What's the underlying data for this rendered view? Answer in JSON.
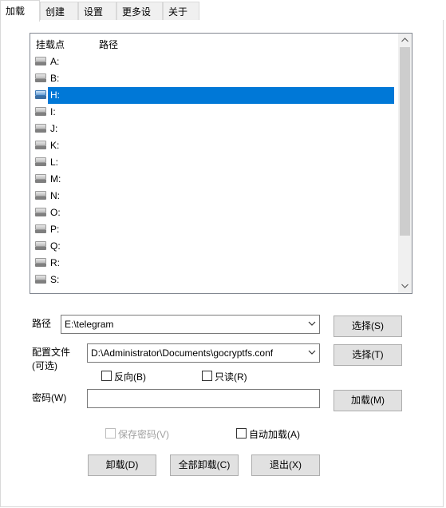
{
  "tabs": [
    {
      "label": "加载",
      "active": true
    },
    {
      "label": "创建",
      "active": false
    },
    {
      "label": "设置",
      "active": false
    },
    {
      "label": "更多设置",
      "active": false
    },
    {
      "label": "关于",
      "active": false
    }
  ],
  "mount_list": {
    "columns": [
      "挂载点",
      "路径"
    ],
    "rows": [
      {
        "drive": "A:",
        "path": ""
      },
      {
        "drive": "B:",
        "path": ""
      },
      {
        "drive": "H:",
        "path": "",
        "selected": true
      },
      {
        "drive": "I:",
        "path": ""
      },
      {
        "drive": "J:",
        "path": ""
      },
      {
        "drive": "K:",
        "path": ""
      },
      {
        "drive": "L:",
        "path": ""
      },
      {
        "drive": "M:",
        "path": ""
      },
      {
        "drive": "N:",
        "path": ""
      },
      {
        "drive": "O:",
        "path": ""
      },
      {
        "drive": "P:",
        "path": ""
      },
      {
        "drive": "Q:",
        "path": ""
      },
      {
        "drive": "R:",
        "path": ""
      },
      {
        "drive": "S:",
        "path": ""
      }
    ]
  },
  "path": {
    "label": "路径",
    "value": "E:\\telegram",
    "button": "选择(S)"
  },
  "config": {
    "label_line1": "配置文件",
    "label_line2": "(可选)",
    "value": "D:\\Administrator\\Documents\\gocryptfs.conf",
    "button": "选择(T)"
  },
  "options": {
    "reverse": "反向(B)",
    "readonly": "只读(R)"
  },
  "password": {
    "label": "密码(W)",
    "value": "",
    "button": "加载(M)"
  },
  "save_password": {
    "label": "保存密码(V)",
    "enabled": false,
    "checked": false
  },
  "auto_mount": {
    "label": "自动加载(A)",
    "checked": false
  },
  "actions": {
    "unmount": "卸载(D)",
    "unmount_all": "全部卸载(C)",
    "exit": "退出(X)"
  },
  "colors": {
    "selection": "#0078d7",
    "button_bg": "#e1e1e1",
    "tab_bg": "#f0f0f0"
  }
}
